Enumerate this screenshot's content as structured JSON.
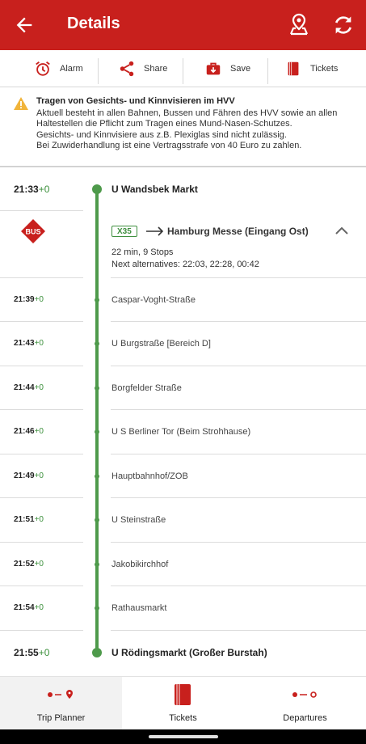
{
  "appbar": {
    "title": "Details",
    "icons": [
      "arrow-left-icon",
      "map-pin-icon",
      "refresh-icon"
    ]
  },
  "actions": [
    {
      "label": "Alarm",
      "icon": "alarm-clock-icon"
    },
    {
      "label": "Share",
      "icon": "share-icon"
    },
    {
      "label": "Save",
      "icon": "briefcase-download-icon"
    },
    {
      "label": "Tickets",
      "icon": "ticket-icon"
    }
  ],
  "notice": {
    "icon": "warning-icon",
    "title": "Tragen von Gesichts- und Kinnvisieren im HVV",
    "lines": [
      "Aktuell besteht in allen Bahnen, Bussen und Fähren des HVV sowie an allen",
      "Haltestellen die Pflicht zum Tragen eines Mund-Nasen-Schutzes.",
      "Gesichts- und Kinnvisiere aus z.B. Plexiglas sind nicht zulässig.",
      "Bei Zuwiderhandlung ist eine Vertragsstrafe von 40 Euro zu zahlen."
    ]
  },
  "trip": {
    "start": {
      "time": "21:33",
      "delay": "+0",
      "name": "U Wandsbek Markt"
    },
    "leg": {
      "mode_icon": "bus-icon",
      "mode_label": "BUS",
      "line": "X35",
      "direction": "Hamburg Messe (Eingang Ost)",
      "duration": "22 min, 9 Stops",
      "alternatives": "Next alternatives: 22:03, 22:28, 00:42"
    },
    "stops": [
      {
        "time": "21:39",
        "delay": "+0",
        "name": "Caspar-Voght-Straße"
      },
      {
        "time": "21:43",
        "delay": "+0",
        "name": "U Burgstraße [Bereich D]"
      },
      {
        "time": "21:44",
        "delay": "+0",
        "name": "Borgfelder Straße"
      },
      {
        "time": "21:46",
        "delay": "+0",
        "name": "U S Berliner Tor (Beim Strohhause)"
      },
      {
        "time": "21:49",
        "delay": "+0",
        "name": "Hauptbahnhof/ZOB"
      },
      {
        "time": "21:51",
        "delay": "+0",
        "name": "U Steinstraße"
      },
      {
        "time": "21:52",
        "delay": "+0",
        "name": "Jakobikirchhof"
      },
      {
        "time": "21:54",
        "delay": "+0",
        "name": "Rathausmarkt"
      }
    ],
    "end": {
      "time": "21:55",
      "delay": "+0",
      "name": "U Rödingsmarkt (Großer Burstah)"
    }
  },
  "bottom_nav": [
    {
      "label": "Trip Planner",
      "icon": "trip-planner-icon",
      "active": true
    },
    {
      "label": "Tickets",
      "icon": "tickets-icon",
      "active": false
    },
    {
      "label": "Departures",
      "icon": "departures-icon",
      "active": false
    }
  ],
  "colors": {
    "brand_red": "#c8201d",
    "line_green": "#4e9a4b",
    "delay_green": "#3a8f3a"
  }
}
